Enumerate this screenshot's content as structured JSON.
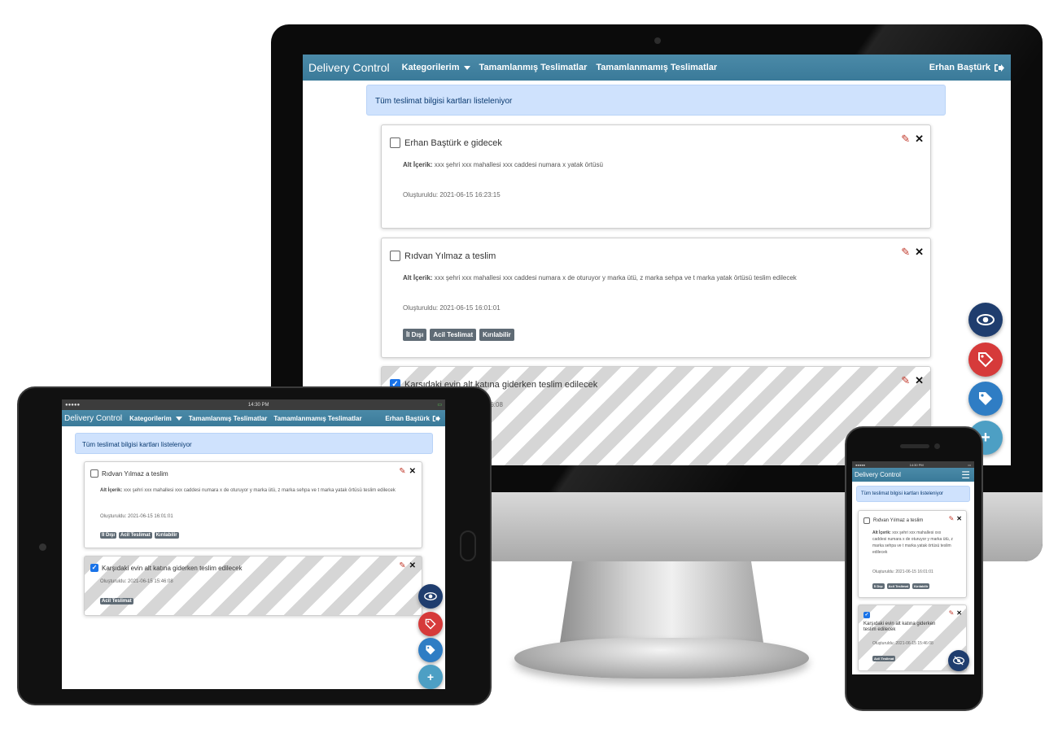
{
  "app": {
    "brand": "Delivery Control",
    "nav": {
      "categories": "Kategorilerim",
      "completed": "Tamamlanmış Teslimatlar",
      "incomplete": "Tamamlanmamış Teslimatlar",
      "user": "Erhan Baştürk"
    },
    "alert": "Tüm teslimat bilgisi kartları listeleniyor",
    "status_time": "14:30 PM",
    "sub_label": "Alt İçerik:",
    "cards": [
      {
        "title": "Erhan Baştürk e gidecek",
        "sub": "xxx şehri xxx mahallesi xxx caddesi numara x yatak örtüsü",
        "date": "Oluşturuldu: 2021-06-15 16:23:15",
        "checked": false
      },
      {
        "title": "Rıdvan Yılmaz a teslim",
        "sub": "xxx şehri xxx mahallesi xxx caddesi numara x de oturuyor y marka ütü, z marka sehpa ve t marka yatak örtüsü teslim edilecek",
        "date": "Oluşturuldu: 2021-06-15 16:01:01",
        "badges": [
          "İl Dışı",
          "Acil Teslimat",
          "Kırılabilir"
        ],
        "checked": false
      },
      {
        "title": "Karşıdaki evin alt katına giderken teslim edilecek",
        "date": "Oluşturuldu: 2021-06-15 15:46:08",
        "date_desktop_partial": "...:46:08",
        "badges": [
          "Acil Teslimat"
        ],
        "checked": true
      }
    ]
  },
  "icons": {
    "edit": "pencil-icon",
    "delete": "close-icon",
    "logout": "sign-out-icon",
    "fab_show": "eye-icon",
    "fab_tag_red": "tag-icon",
    "fab_tag_blue": "tag-icon",
    "fab_add": "plus-icon",
    "fab_hide": "eye-slash-icon"
  },
  "colors": {
    "navbar": "#3f819f",
    "alert_bg": "#cfe2fd",
    "fab_eye": "#1f3d6e",
    "fab_tag_red": "#d63a3a",
    "fab_tag_blue": "#2f7dc4",
    "fab_plus": "#4d9fc4",
    "badge": "#5f6b75"
  }
}
